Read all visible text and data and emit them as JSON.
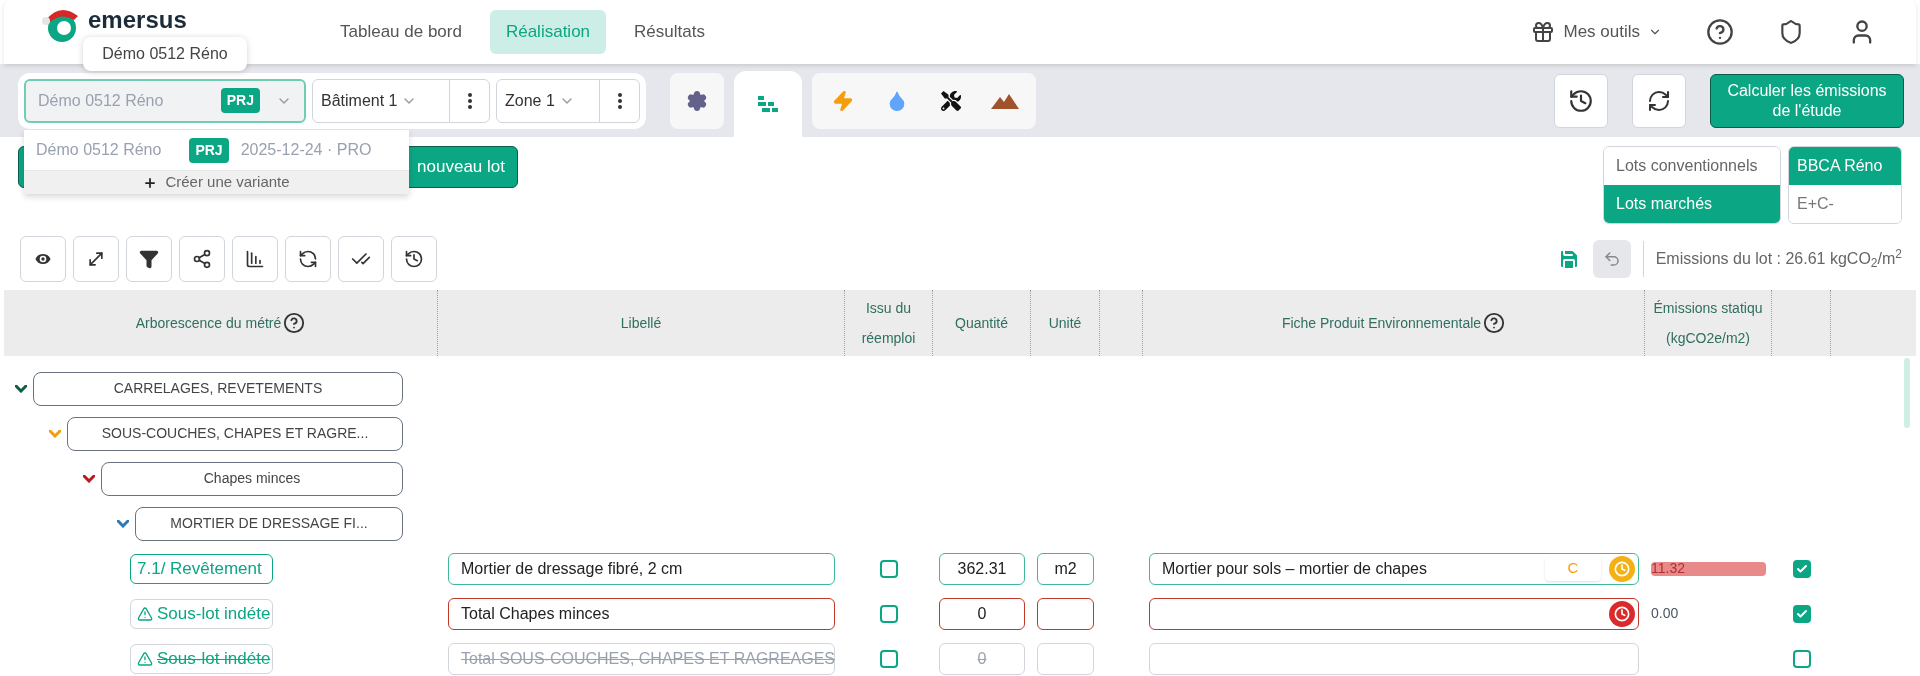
{
  "logo": {
    "text": "emersus"
  },
  "tooltip": {
    "text": "Démo 0512 Réno"
  },
  "nav": [
    {
      "label": "Tableau de bord",
      "selected": false
    },
    {
      "label": "Réalisation",
      "selected": true
    },
    {
      "label": "Résultats",
      "selected": false
    }
  ],
  "tools_menu": {
    "label": "Mes outils"
  },
  "project_select": {
    "value": "Démo 0512 Réno",
    "badge": "PRJ"
  },
  "building_select": {
    "value": "Bâtiment 1"
  },
  "zone_select": {
    "value": "Zone 1"
  },
  "project_dropdown": {
    "option": {
      "name": "Démo 0512 Réno",
      "badge": "PRJ",
      "meta": "2025-12-24 · PRO"
    },
    "action": "Créer une variante"
  },
  "category_tabs": [
    {
      "kind": "settings",
      "selected": false
    },
    {
      "kind": "bricks",
      "selected": true
    },
    {
      "kind": "energy",
      "selected": false
    },
    {
      "kind": "water",
      "selected": false
    },
    {
      "kind": "tools",
      "selected": false
    },
    {
      "kind": "terrain",
      "selected": false
    }
  ],
  "calculate_button": "Calculer les émissions de l'étude",
  "add_lot_button": "nouveau lot",
  "lot_types": [
    {
      "label": "Lots conventionnels",
      "selected": false
    },
    {
      "label": "Lots marchés",
      "selected": true
    }
  ],
  "norms": [
    {
      "label": "BBCA Réno",
      "selected": true
    },
    {
      "label": "E+C-",
      "selected": false
    }
  ],
  "emissions_summary": "Emissions du lot : 26.61 kgCO$_{2}$/m$^{2}$",
  "table": {
    "columns": [
      {
        "label": "Arborescence du métré",
        "help": true
      },
      {
        "label": "Libellé"
      },
      {
        "label": "Issu du réemploi"
      },
      {
        "label": "Quantité"
      },
      {
        "label": "Unité"
      },
      {
        "label": "Fiche Produit Environnementale",
        "help": true
      },
      {
        "label": "Émissions statiqu (kgCO2e/m2)"
      }
    ],
    "tree": [
      {
        "label": "CARRELAGES, REVETEMENTS",
        "color": "#0d5c46",
        "children": [
          {
            "label": "SOUS-COUCHES, CHAPES ET RAGRE...",
            "color": "#f59e0b",
            "children": [
              {
                "label": "Chapes minces",
                "color": "#b91c1c",
                "children": [
                  {
                    "label": "MORTIER DE DRESSAGE FI...",
                    "color": "#2b7bb9"
                  }
                ]
              }
            ]
          }
        ]
      }
    ],
    "rows": [
      {
        "label": "7.1/ Revêtement",
        "error": false,
        "disabled": false,
        "warning": false,
        "libelle": "Mortier de dressage fibré, 2 cm",
        "reemploi": false,
        "quantity": "362.31",
        "unit": "m2",
        "fpe": "Mortier pour sols – mortier de chapes",
        "fpe_badge": "C",
        "fpe_clock": true,
        "emission": "11.32",
        "emission_alert": true,
        "included": true
      },
      {
        "label": "Sous-lot indéte",
        "error": true,
        "disabled": false,
        "warning": true,
        "libelle": "Total Chapes minces",
        "reemploi": false,
        "quantity": "0",
        "fpe_clock": true,
        "emission": "0.00",
        "emission_alert": false,
        "included": true
      },
      {
        "label": "Sous-lot indéte",
        "error": false,
        "disabled": true,
        "warning": true,
        "libelle": "Total SOUS-COUCHES, CHAPES ET RAGREAGES",
        "reemploi": false,
        "quantity": "0",
        "fpe_clock": false,
        "included": false
      }
    ]
  }
}
